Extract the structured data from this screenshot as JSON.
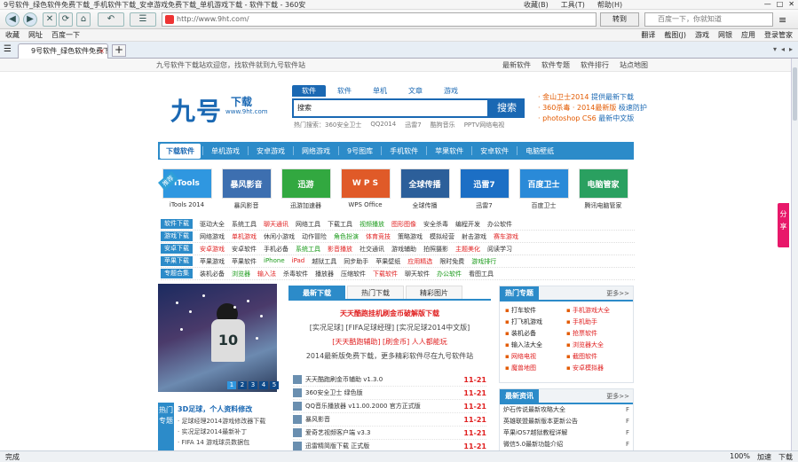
{
  "window": {
    "title": "9号软件_绿色软件免费下载_手机软件下载_安卓游戏免费下载_单机游戏下载 - 软件下载 - 360安全浏览器",
    "menu": [
      "收藏(B)",
      "工具(T)",
      "帮助(H)"
    ],
    "win_controls": [
      "—",
      "□",
      "✕"
    ]
  },
  "toolbar": {
    "back": "◀",
    "forward": "▶",
    "stop": "✕",
    "refresh": "⟳",
    "home": "⌂",
    "address": "http://www.9ht.com/",
    "go_label": "转到",
    "search_placeholder": "百度一下，你就知道"
  },
  "favorites": {
    "left": [
      "收藏",
      "网址",
      "百度一下"
    ],
    "right": [
      "翻译",
      "截图(J)",
      "游戏",
      "网银",
      "应用",
      "登录管家"
    ]
  },
  "tab": {
    "title": "9号软件_绿色软件免费下载",
    "close": "×",
    "new": "+"
  },
  "site": {
    "topline": "九号软件下载站欢迎您，找软件就到九号软件站",
    "top_links": [
      "最新软件",
      "软件专题",
      "软件排行",
      "站点地图"
    ],
    "logo_main": "九号",
    "logo_sub": "下载",
    "logo_url": "www.9ht.com",
    "search_tabs": [
      "软件",
      "软件",
      "单机",
      "文章",
      "游戏"
    ],
    "search_value": "搜索",
    "search_button": "搜索",
    "hot_words": [
      "热门搜索：360安全卫士",
      "QQ2014",
      "迅雷7",
      "酷狗音乐",
      "PPTV网络电视",
      "美图秀秀"
    ],
    "news": [
      {
        "a": "· 金山卫士2014",
        "b": "提供最新下载"
      },
      {
        "a": "· 360杀毒 · 2014最新版",
        "b": "极速防护"
      },
      {
        "a": "· photoshop CS6",
        "b": "最新中文版"
      }
    ],
    "nav": [
      "下载软件",
      "单机游戏",
      "安卓游戏",
      "网络游戏",
      "9号图库",
      "手机软件",
      "苹果软件",
      "安卓软件",
      "电脑壁纸"
    ],
    "recommend_badge": "推荐",
    "apps": [
      {
        "label": "iTools 2014",
        "text": "iTools",
        "color": "#2f97e0"
      },
      {
        "label": "暴风影音",
        "text": "暴风影音",
        "color": "#3d6fb0"
      },
      {
        "label": "迅游加速器",
        "text": "迅游",
        "color": "#32a840"
      },
      {
        "label": "WPS Office",
        "text": "W P S",
        "color": "#e05a28"
      },
      {
        "label": "全球传播",
        "text": "全球传播",
        "color": "#2c5f9a"
      },
      {
        "label": "迅雷7",
        "text": "迅雷7",
        "color": "#1c6fc5"
      },
      {
        "label": "百度卫士",
        "text": "百度卫士",
        "color": "#2a8ad8"
      },
      {
        "label": "腾讯电脑管家",
        "text": "电脑管家",
        "color": "#2aa060"
      }
    ],
    "categories": [
      {
        "title": "软件下载",
        "items": [
          "驱动大全",
          "系统工具",
          "聊天通讯",
          "网络工具",
          "下载工具",
          "视频播放",
          "图形图像",
          "安全杀毒",
          "编程开发",
          "办公软件"
        ]
      },
      {
        "title": "游戏下载",
        "items": [
          "网络游戏",
          "单机游戏",
          "休闲小游戏",
          "动作冒险",
          "角色扮演",
          "体育竞技",
          "策略游戏",
          "模拟经营",
          "射击游戏",
          "赛车游戏"
        ]
      },
      {
        "title": "安卓下载",
        "items": [
          "安卓游戏",
          "安卓软件",
          "手机必备",
          "系统工具",
          "影音播放",
          "社交通讯",
          "游戏辅助",
          "拍照摄影",
          "主题美化",
          "阅读学习"
        ]
      },
      {
        "title": "苹果下载",
        "items": [
          "苹果游戏",
          "苹果软件",
          "iPhone",
          "iPad",
          "越狱工具",
          "同步助手",
          "苹果壁纸",
          "应用精选",
          "限时免费",
          "游戏排行"
        ]
      },
      {
        "title": "专题合集",
        "items": [
          "装机必备",
          "浏览器",
          "输入法",
          "杀毒软件",
          "播放器",
          "压缩软件",
          "下载软件",
          "聊天软件",
          "办公软件",
          "看图工具"
        ]
      }
    ],
    "banner_number": "10",
    "banner_dots": [
      "1",
      "2",
      "3",
      "4",
      "5"
    ],
    "news_side": "热门专题",
    "news_title": "3D足球，个人资料修改",
    "news_lines": [
      "· 足球经理2014游戏修改器下载",
      "· 实况足球2014最新补丁",
      "· FIFA 14 游戏球员数据包"
    ],
    "main_tabs": [
      "最新下载",
      "热门下载",
      "精彩图片"
    ],
    "promo": {
      "line1": "天天酷跑挂机刷金币破解版下载",
      "line2": "[实况足球] [FIFA足球经理] [实况足球2014中文版]",
      "line3": "[天天酷跑辅助] [刷金币]   人人都能玩",
      "line4": "2014最新版免费下载，更多精彩软件尽在九号软件站"
    },
    "downloads": [
      {
        "name": "天天酷跑刷金币辅助 v1.3.0",
        "date": "11-21"
      },
      {
        "name": "360安全卫士 绿色版",
        "date": "11-21"
      },
      {
        "name": "QQ音乐播放器 v11.00.2000 官方正式版",
        "date": "11-21"
      },
      {
        "name": "暴风影音",
        "date": "11-21"
      },
      {
        "name": "爱奇艺视频客户端 v3.3",
        "date": "11-21"
      },
      {
        "name": "迅雷精简版下载 正式版",
        "date": "11-21"
      }
    ],
    "hotspec": {
      "title": "热门专题",
      "more": "更多>>",
      "items": [
        "打车软件",
        "手机游戏大全",
        "打飞机游戏",
        "手机助手",
        "装机必备",
        "抢票软件",
        "输入法大全",
        "浏览器大全",
        "网络电视",
        "截图软件",
        "魔兽地图",
        "安卓模拟器"
      ]
    },
    "latest": {
      "title": "最新资讯",
      "more": "更多>>",
      "items": [
        {
          "name": "炉石传说最新攻略大全",
          "date": "F"
        },
        {
          "name": "英雄联盟最新版本更新公告",
          "date": "F"
        },
        {
          "name": "苹果iOS7越狱教程详解",
          "date": "F"
        },
        {
          "name": "微信5.0最新功能介绍",
          "date": "F"
        }
      ]
    },
    "share": "分享"
  },
  "status": {
    "left": "完成",
    "right": [
      "100%",
      "加速",
      "下载"
    ]
  }
}
